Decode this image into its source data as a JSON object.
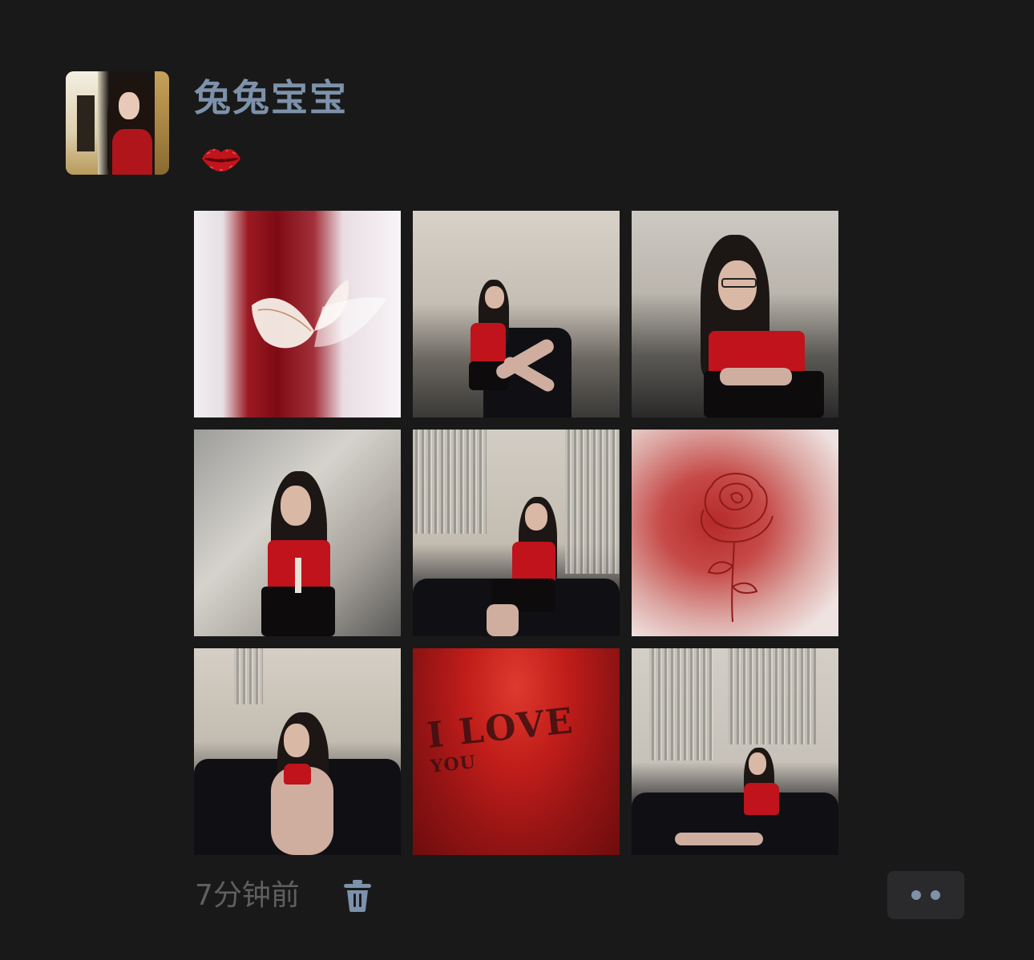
{
  "post": {
    "author_name": "兔兔宝宝",
    "status_icon": "kiss-lips-icon",
    "timestamp": "7分钟前",
    "delete_icon": "trash-icon",
    "more_icon": "more-dots-icon"
  },
  "images": [
    {
      "subject": "butterfly"
    },
    {
      "subject": "woman-in-lounge"
    },
    {
      "subject": "woman-portrait"
    },
    {
      "subject": "woman-standing"
    },
    {
      "subject": "woman-on-sofa"
    },
    {
      "subject": "rose-sketch"
    },
    {
      "subject": "woman-seated"
    },
    {
      "subject": "love-text",
      "text_main": "I LOVE",
      "text_small": "YOU"
    },
    {
      "subject": "woman-lounging"
    }
  ],
  "colors": {
    "background": "#191919",
    "name": "#7d91aa",
    "timestamp": "#5f5f62",
    "more_button_bg": "#2a2a2c",
    "accent": "#7d91aa"
  }
}
